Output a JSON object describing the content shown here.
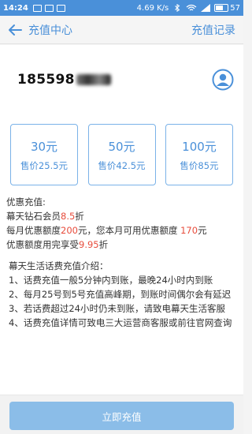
{
  "status_bar": {
    "time": "14:24",
    "network": "4.69 K/s",
    "battery": "57"
  },
  "header": {
    "title": "充值中心",
    "history_link": "充值记录"
  },
  "account": {
    "phone_prefix": "185598"
  },
  "options": [
    {
      "amount": "30元",
      "price": "售价25.5元"
    },
    {
      "amount": "50元",
      "price": "售价42.5元"
    },
    {
      "amount": "100元",
      "price": "售价85元"
    }
  ],
  "discount": {
    "heading": "优惠充值:",
    "line1_pre": "幕天钻石会员",
    "line1_value": "8.5",
    "line1_post": "折",
    "line2_pre": "每月优惠额度",
    "line2_value": "200",
    "line2_mid": "元，您本月可用优惠额度 ",
    "line2_value2": "170",
    "line2_post": "元",
    "line3_pre": "优惠额度用完享受",
    "line3_value": "9.95",
    "line3_post": "折"
  },
  "intro": {
    "title": "幕天生活话费充值介绍：",
    "items": [
      "1、话费充值一般5分钟内到账，最晚24小时内到账",
      "2、每月25号到5号充值高峰期，到账时间偶尔会有延迟",
      "3、若话费超过24小时仍未到账，请致电幕天生活客服",
      "4、话费充值详情可致电三大运营商客服或前往官网查询"
    ]
  },
  "submit_button": "立即充值",
  "colors": {
    "primary": "#4a90d9",
    "accent_red": "#e74c3c",
    "button": "#8bbde8"
  }
}
